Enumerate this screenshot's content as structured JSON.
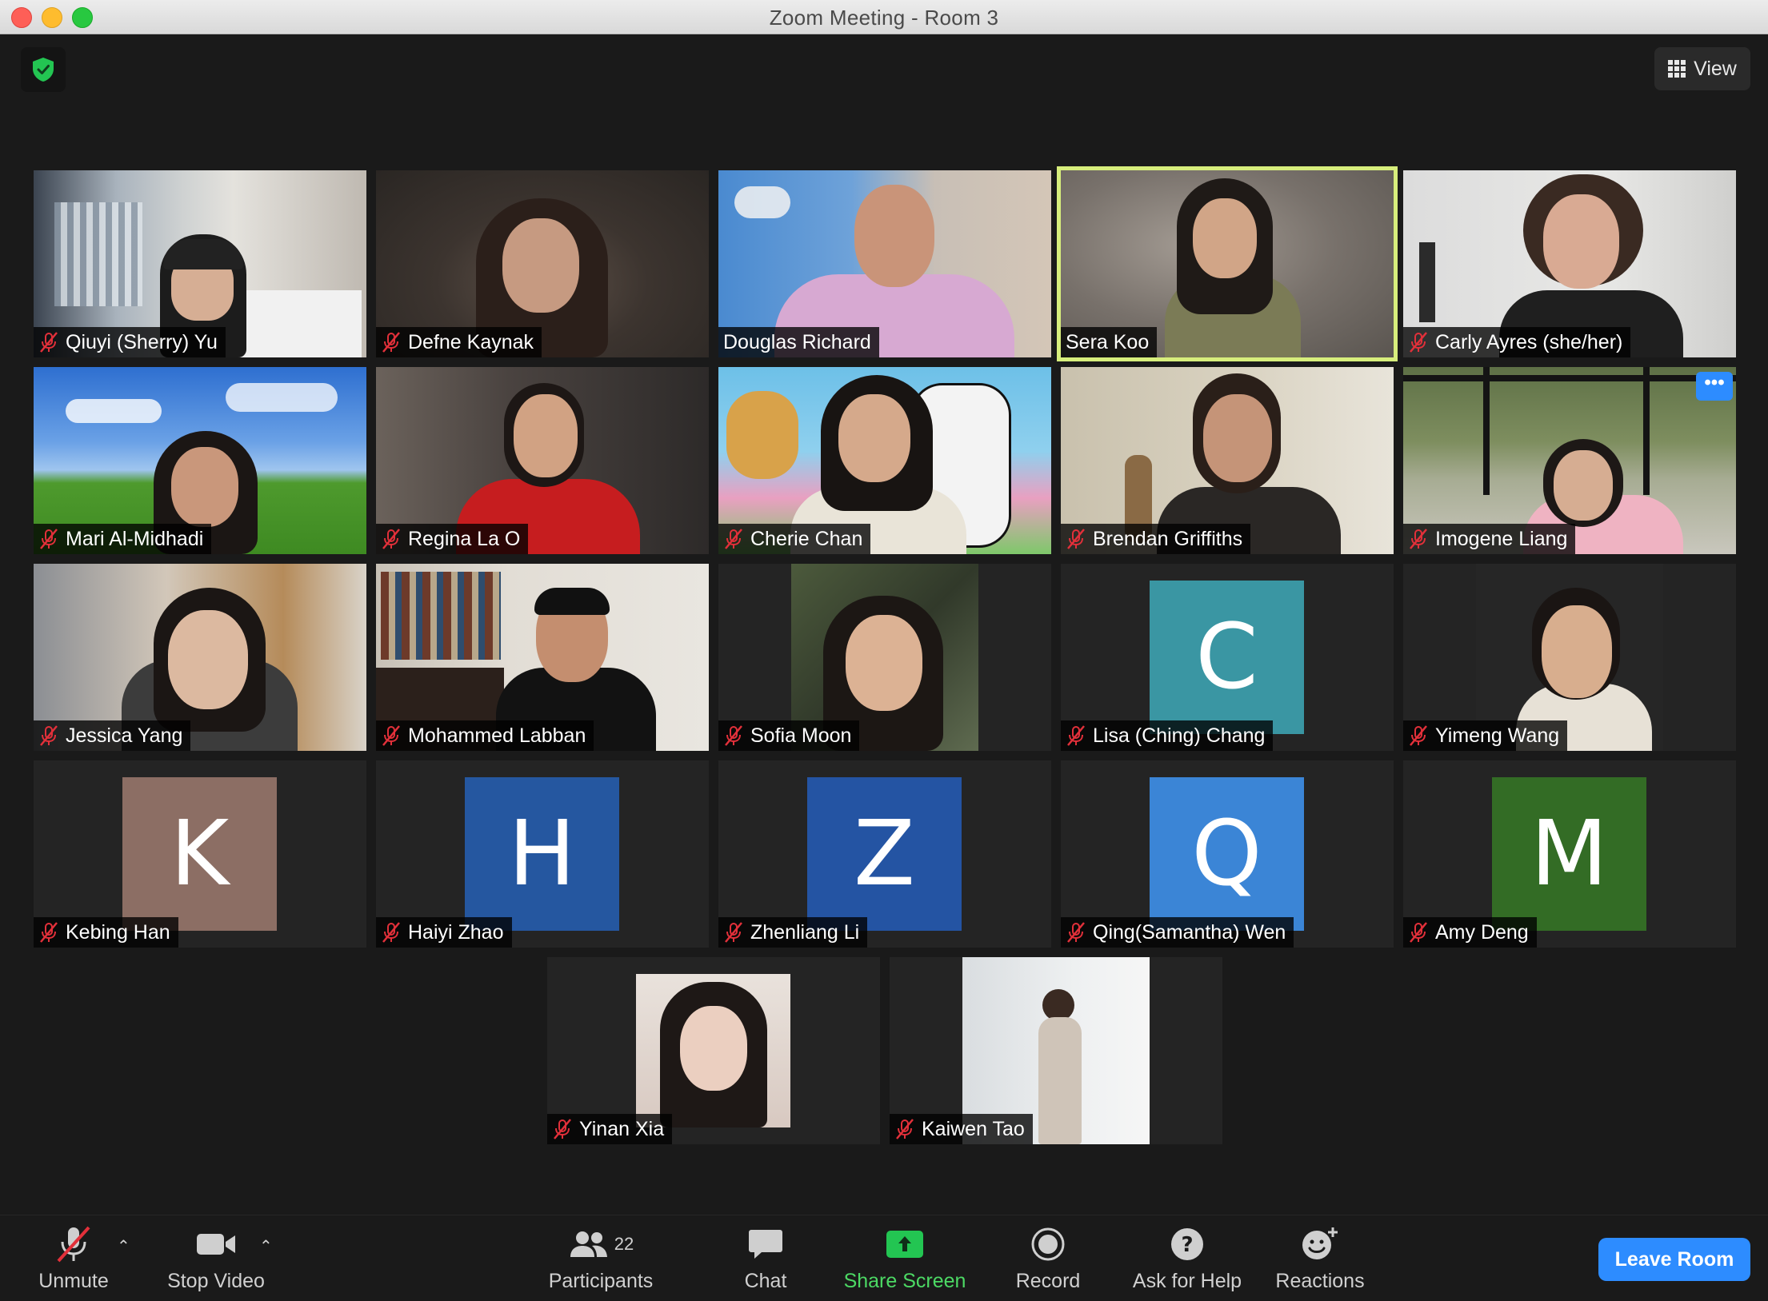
{
  "window": {
    "title": "Zoom Meeting - Room 3"
  },
  "top": {
    "view_label": "View"
  },
  "colors": {
    "accent": "#2d8cff",
    "speaking_border": "#d7ee7c",
    "share_green": "#4cd964",
    "mute_red": "#e2303a"
  },
  "participants": [
    {
      "name": "Qiuyi (Sherry) Yu",
      "muted": true
    },
    {
      "name": "Defne Kaynak",
      "muted": true
    },
    {
      "name": "Douglas Richard",
      "muted": false
    },
    {
      "name": "Sera Koo",
      "muted": false,
      "speaking": true
    },
    {
      "name": "Carly Ayres (she/her)",
      "muted": true
    },
    {
      "name": "Mari Al-Midhadi",
      "muted": true
    },
    {
      "name": "Regina La O",
      "muted": true
    },
    {
      "name": "Cherie Chan",
      "muted": true
    },
    {
      "name": "Brendan Griffiths",
      "muted": true
    },
    {
      "name": "Imogene Liang",
      "muted": true,
      "more_icon": "ellipsis-icon"
    },
    {
      "name": "Jessica Yang",
      "muted": true
    },
    {
      "name": "Mohammed Labban",
      "muted": true
    },
    {
      "name": "Sofia Moon",
      "muted": true
    },
    {
      "name": "Lisa (Ching) Chang",
      "muted": true,
      "initial": "C",
      "avatar_color": "#3a96a3"
    },
    {
      "name": "Yimeng Wang",
      "muted": true
    },
    {
      "name": "Kebing Han",
      "muted": true,
      "initial": "K",
      "avatar_color": "#8c6e64"
    },
    {
      "name": "Haiyi Zhao",
      "muted": true,
      "initial": "H",
      "avatar_color": "#2557a0"
    },
    {
      "name": "Zhenliang Li",
      "muted": true,
      "initial": "Z",
      "avatar_color": "#2454a3"
    },
    {
      "name": "Qing(Samantha) Wen",
      "muted": true,
      "initial": "Q",
      "avatar_color": "#3b85d6"
    },
    {
      "name": "Amy Deng",
      "muted": true,
      "initial": "M",
      "avatar_color": "#336c25"
    },
    {
      "name": "Yinan Xia",
      "muted": true
    },
    {
      "name": "Kaiwen Tao",
      "muted": true
    }
  ],
  "toolbar": {
    "unmute_label": "Unmute",
    "stop_video_label": "Stop Video",
    "participants_label": "Participants",
    "participants_count": "22",
    "chat_label": "Chat",
    "share_screen_label": "Share Screen",
    "record_label": "Record",
    "help_label": "Ask for Help",
    "reactions_label": "Reactions",
    "leave_label": "Leave Room"
  }
}
